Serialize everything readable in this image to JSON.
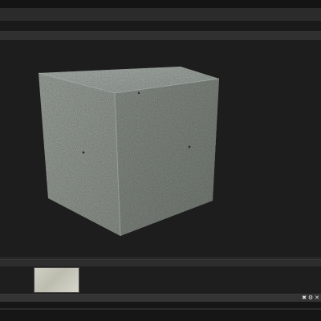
{
  "viewport": {
    "model": "concrete-cube",
    "colors": {
      "top_face": "#9aa19c",
      "left_face": "#8b918b",
      "right_face": "#7a807a",
      "background": "#1d1d1d"
    }
  },
  "thumbnails": [
    {
      "icon": "concrete-texture-thumbnail"
    }
  ],
  "status_bar": {
    "buttons": [
      {
        "icon": "pin-icon",
        "glyph": "✖"
      },
      {
        "icon": "gear-icon",
        "glyph": "⚙"
      },
      {
        "icon": "close-icon",
        "glyph": "✕"
      }
    ]
  }
}
